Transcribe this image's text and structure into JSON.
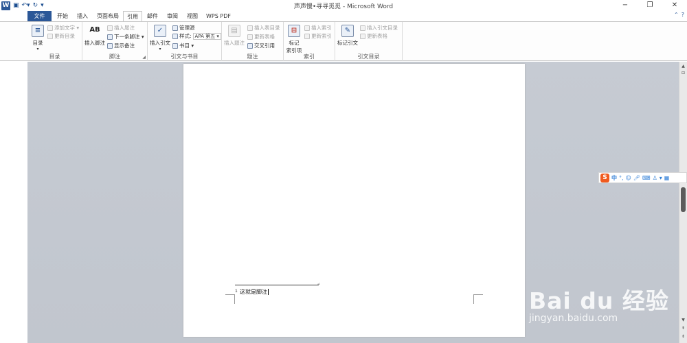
{
  "window": {
    "title": "声声慢•寻寻觅觅 - Microsoft Word",
    "app_icon_letter": "W",
    "qat": [
      "save-icon",
      "undo-icon",
      "redo-icon",
      "customize-icon"
    ],
    "controls": {
      "minimize": "−",
      "restore": "❐",
      "close": "✕"
    }
  },
  "tabs": {
    "file": "文件",
    "items": [
      "开始",
      "插入",
      "页面布局",
      "引用",
      "邮件",
      "审阅",
      "视图",
      "WPS PDF"
    ],
    "active": "引用",
    "right": {
      "collapse": "⌃",
      "help": "?"
    }
  },
  "ribbon": {
    "toc": {
      "label": "目录",
      "big": "目录",
      "add_text": "添加文字 ▾",
      "update_table": "更新目录"
    },
    "footnotes": {
      "label": "脚注",
      "insert_footnote": "插入脚注",
      "insert_endnote": "插入尾注",
      "next_footnote": "下一条脚注 ▾",
      "show_notes": "显示备注",
      "big_icon_text": "AB"
    },
    "citations": {
      "label": "引文与书目",
      "insert_citation": "插入引文",
      "manage_sources": "管理源",
      "style_label": "样式:",
      "style_value": "APA 第五 ▾",
      "bibliography": "书目 ▾"
    },
    "captions": {
      "label": "题注",
      "insert_caption": "插入题注",
      "insert_table_of_figures": "插入表目录",
      "update_table": "更新表格",
      "cross_reference": "交叉引用"
    },
    "index": {
      "label": "索引",
      "mark_entry_line1": "标记",
      "mark_entry_line2": "索引项",
      "insert_index": "插入索引",
      "update_index": "更新索引"
    },
    "toa": {
      "label": "引文目录",
      "mark_citation": "标记引文",
      "insert_toa": "插入引文目录",
      "update_table": "更新表格"
    }
  },
  "document": {
    "footnote_number": "1",
    "footnote_text": "这就是脚注",
    "separator_mark": "↵"
  },
  "ime": {
    "logo": "S",
    "mode": "中",
    "icons": [
      "punctuation-icon",
      "emoji-icon",
      "voice-icon",
      "keyboard-icon",
      "skin-icon",
      "shirt-icon",
      "grid-icon"
    ]
  },
  "watermark": {
    "brand": "Bai du 经验",
    "url": "jingyan.baidu.com"
  }
}
